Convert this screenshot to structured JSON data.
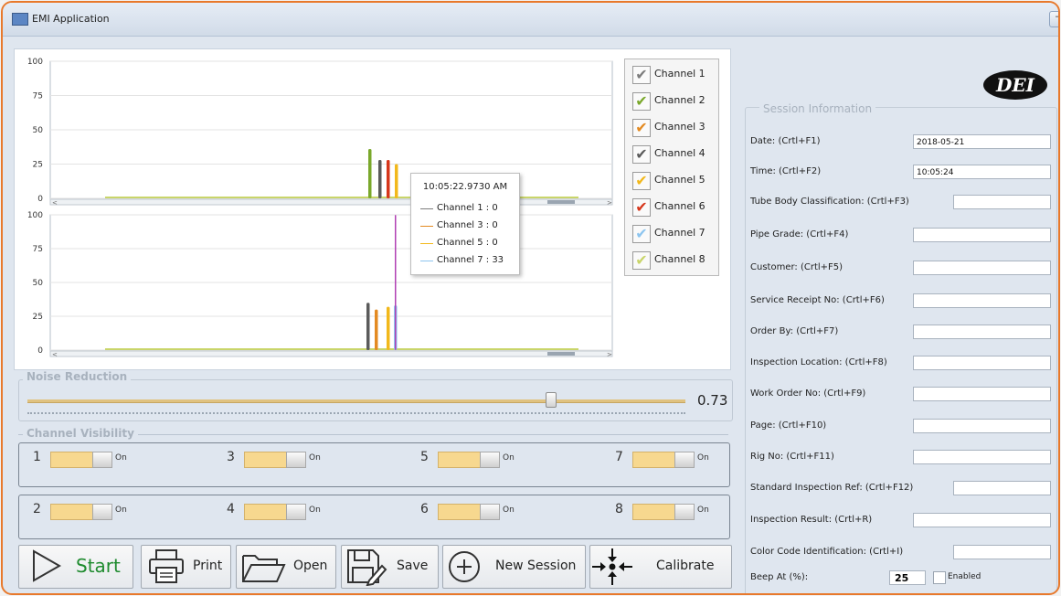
{
  "window": {
    "title": "EMI Application",
    "min_label": "—",
    "max_label": "□",
    "close_label": "✕"
  },
  "logo_text": "DEI",
  "chart_data": [
    {
      "type": "bar",
      "name": "upper",
      "ylim": [
        0,
        100
      ],
      "yticks": [
        "0",
        "25",
        "50",
        "75",
        "100"
      ],
      "grid": true,
      "series": [
        {
          "name": "Channel 2",
          "values": [
            36
          ]
        },
        {
          "name": "Channel 4",
          "values": [
            28
          ]
        },
        {
          "name": "Channel 6",
          "values": [
            28
          ]
        },
        {
          "name": "Channel 5",
          "values": [
            25
          ]
        }
      ]
    },
    {
      "type": "bar",
      "name": "lower",
      "ylim": [
        0,
        100
      ],
      "yticks": [
        "0",
        "25",
        "50",
        "75",
        "100"
      ],
      "grid": true,
      "series": [
        {
          "name": "Channel 4",
          "values": [
            35
          ]
        },
        {
          "name": "Channel 3",
          "values": [
            30
          ]
        },
        {
          "name": "Channel 5",
          "values": [
            32
          ]
        },
        {
          "name": "Channel 7",
          "values": [
            33
          ]
        },
        {
          "name": "Channel 8",
          "values": [
            100
          ]
        }
      ]
    }
  ],
  "legend": [
    {
      "label": "Channel 1",
      "color": "#7d7d7d"
    },
    {
      "label": "Channel 2",
      "color": "#7aa82b"
    },
    {
      "label": "Channel 3",
      "color": "#e38a21"
    },
    {
      "label": "Channel 4",
      "color": "#5b5b5b"
    },
    {
      "label": "Channel 5",
      "color": "#f2b81b"
    },
    {
      "label": "Channel 6",
      "color": "#d6361b"
    },
    {
      "label": "Channel 7",
      "color": "#8dc5ef"
    },
    {
      "label": "Channel 8",
      "color": "#c9d56a"
    }
  ],
  "tooltip": {
    "time": "10:05:22.9730 AM",
    "rows": [
      {
        "text": "Channel 1 : 0",
        "color": "#7d7d7d"
      },
      {
        "text": "Channel 3 : 0",
        "color": "#e38a21"
      },
      {
        "text": "Channel 5 : 0",
        "color": "#f2b81b"
      },
      {
        "text": "Channel 7 : 33",
        "color": "#8dc5ef"
      }
    ]
  },
  "noise": {
    "title": "Noise Reduction",
    "value": "0.73",
    "level": 0.795
  },
  "visibility": {
    "title": "Channel Visibility",
    "channels": [
      {
        "num": "1",
        "state": "On"
      },
      {
        "num": "3",
        "state": "On"
      },
      {
        "num": "5",
        "state": "On"
      },
      {
        "num": "7",
        "state": "On"
      },
      {
        "num": "2",
        "state": "On"
      },
      {
        "num": "4",
        "state": "On"
      },
      {
        "num": "6",
        "state": "On"
      },
      {
        "num": "8",
        "state": "On"
      }
    ]
  },
  "buttons": {
    "start": "Start",
    "print": "Print",
    "open": "Open",
    "save": "Save",
    "new_session": "New Session",
    "calibrate": "Calibrate"
  },
  "session": {
    "title": "Session Information",
    "fields": [
      {
        "label": "Date: (Crtl+F1)",
        "value": "2018-05-21"
      },
      {
        "label": "Time: (Crtl+F2)",
        "value": "10:05:24"
      },
      {
        "label": "Tube Body Classification: (Crtl+F3)",
        "value": ""
      },
      {
        "label": "Pipe Grade: (Crtl+F4)",
        "value": ""
      },
      {
        "label": "Customer: (Crtl+F5)",
        "value": ""
      },
      {
        "label": "Service Receipt No: (Crtl+F6)",
        "value": ""
      },
      {
        "label": "Order By: (Crtl+F7)",
        "value": ""
      },
      {
        "label": "Inspection Location: (Crtl+F8)",
        "value": ""
      },
      {
        "label": "Work Order No: (Crtl+F9)",
        "value": ""
      },
      {
        "label": "Page: (Crtl+F10)",
        "value": ""
      },
      {
        "label": "Rig No: (Crtl+F11)",
        "value": ""
      },
      {
        "label": "Standard Inspection Ref: (Crtl+F12)",
        "value": ""
      },
      {
        "label": "Inspection Result: (Crtl+R)",
        "value": ""
      },
      {
        "label": "Color Code Identification: (Crtl+I)",
        "value": ""
      }
    ],
    "beep": {
      "label": "Beep At (%):",
      "value": "25",
      "enabled_label": "Enabled"
    }
  }
}
